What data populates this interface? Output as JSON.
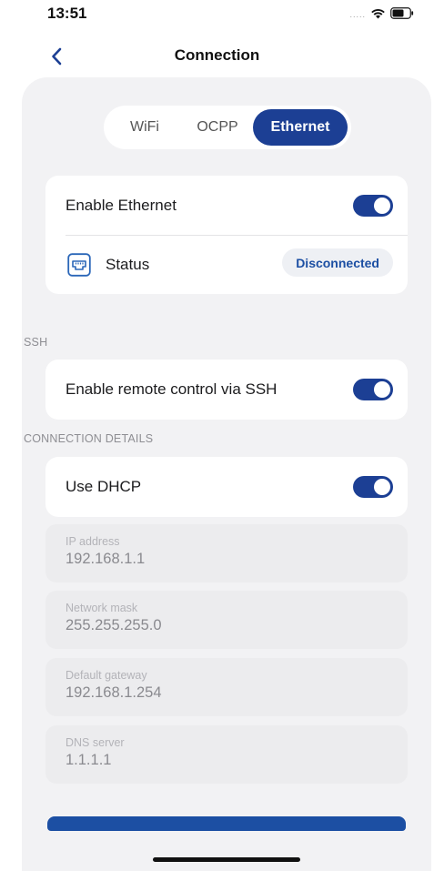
{
  "status_bar": {
    "time": "13:51",
    "signal": "....."
  },
  "nav": {
    "title": "Connection"
  },
  "tabs": [
    {
      "label": "WiFi"
    },
    {
      "label": "OCPP"
    },
    {
      "label": "Ethernet",
      "selected": true
    }
  ],
  "ethernet_card": {
    "enable_label": "Enable Ethernet",
    "enable_on": true,
    "status_label": "Status",
    "status_value": "Disconnected"
  },
  "ssh_section": {
    "title": "SSH",
    "toggle_label": "Enable remote control via SSH",
    "toggle_on": true
  },
  "details_section": {
    "title": "CONNECTION DETAILS",
    "dhcp_label": "Use DHCP",
    "dhcp_on": true,
    "fields": [
      {
        "label": "IP address",
        "value": "192.168.1.1"
      },
      {
        "label": "Network mask",
        "value": "255.255.255.0"
      },
      {
        "label": "Default gateway",
        "value": "192.168.1.254"
      },
      {
        "label": "DNS server",
        "value": "1.1.1.1"
      }
    ]
  },
  "colors": {
    "accent": "#1c3f94",
    "badge_text": "#1c4fa3",
    "sheet_bg": "#f2f2f4"
  },
  "icons": {
    "back": "chevron-left-icon",
    "status": "ethernet-port-icon",
    "wifi": "wifi-icon",
    "battery": "battery-icon"
  }
}
